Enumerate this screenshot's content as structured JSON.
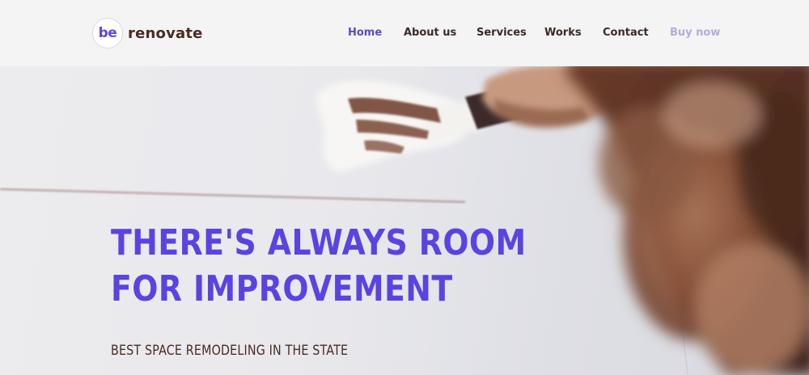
{
  "brand": {
    "badge": "be",
    "name": "renovate",
    "accent_color": "#5a45e6",
    "text_color": "#4a2a24"
  },
  "nav": {
    "items": [
      {
        "label": "Home",
        "state": "active"
      },
      {
        "label": "About us",
        "state": "normal"
      },
      {
        "label": "Services",
        "state": "normal"
      },
      {
        "label": "Works",
        "state": "normal"
      },
      {
        "label": "Contact",
        "state": "normal"
      },
      {
        "label": "Buy now",
        "state": "muted"
      }
    ]
  },
  "hero": {
    "title_line_1": "THERE'S ALWAYS ROOM",
    "title_line_2": "FOR IMPROVEMENT",
    "subtitle": "BEST SPACE REMODELING IN THE STATE",
    "title_color": "#5b43e2",
    "image": "hand applying plaster with a putty knife"
  }
}
